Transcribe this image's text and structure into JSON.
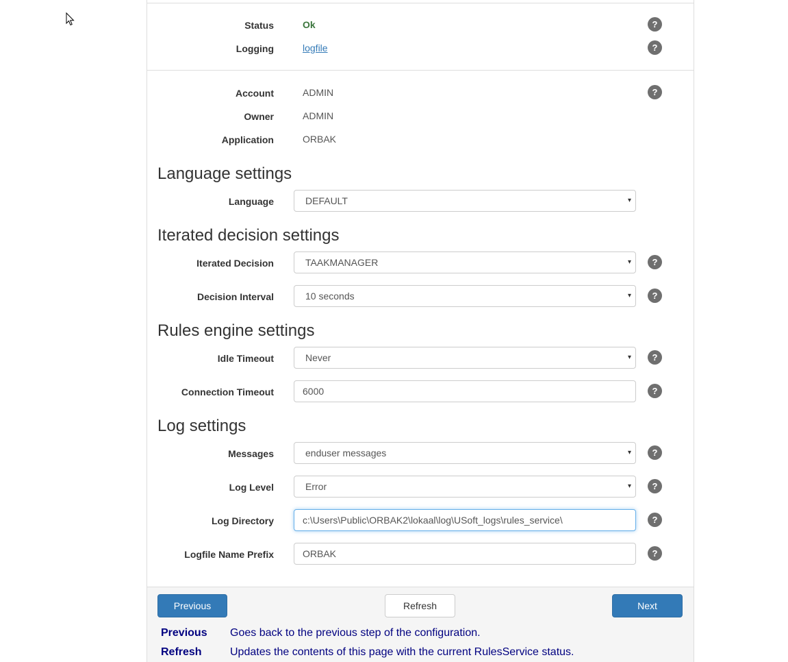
{
  "status_block": {
    "status_label": "Status",
    "status_value": "Ok",
    "logging_label": "Logging",
    "logging_link": "logfile"
  },
  "identity": {
    "account_label": "Account",
    "account_value": "ADMIN",
    "owner_label": "Owner",
    "owner_value": "ADMIN",
    "application_label": "Application",
    "application_value": "ORBAK"
  },
  "language_settings": {
    "heading": "Language settings",
    "language_label": "Language",
    "language_value": "DEFAULT"
  },
  "iterated_settings": {
    "heading": "Iterated decision settings",
    "decision_label": "Iterated Decision",
    "decision_value": "TAAKMANAGER",
    "interval_label": "Decision Interval",
    "interval_value": "10 seconds"
  },
  "rules_engine": {
    "heading": "Rules engine settings",
    "idle_label": "Idle Timeout",
    "idle_value": "Never",
    "connection_label": "Connection Timeout",
    "connection_value": "6000"
  },
  "log_settings": {
    "heading": "Log settings",
    "messages_label": "Messages",
    "messages_value": "enduser messages",
    "level_label": "Log Level",
    "level_value": "Error",
    "directory_label": "Log Directory",
    "directory_value": "c:\\Users\\Public\\ORBAK2\\lokaal\\log\\USoft_logs\\rules_service\\",
    "prefix_label": "Logfile Name Prefix",
    "prefix_value": "ORBAK"
  },
  "help_glyph": "?",
  "dropdown_caret": "▾",
  "footer": {
    "previous_button": "Previous",
    "refresh_button": "Refresh",
    "next_button": "Next",
    "descriptions": [
      {
        "key": "Previous",
        "text": "Goes back to the previous step of the configuration."
      },
      {
        "key": "Refresh",
        "text": "Updates the contents of this page with the current RulesService status."
      }
    ]
  },
  "colors": {
    "primary": "#337ab7",
    "ok": "#3c763d",
    "help_icon": "#6f6f6f",
    "description_text": "#000080"
  },
  "icons": [
    "mouse-cursor-icon",
    "help-icon",
    "dropdown-caret-icon"
  ]
}
